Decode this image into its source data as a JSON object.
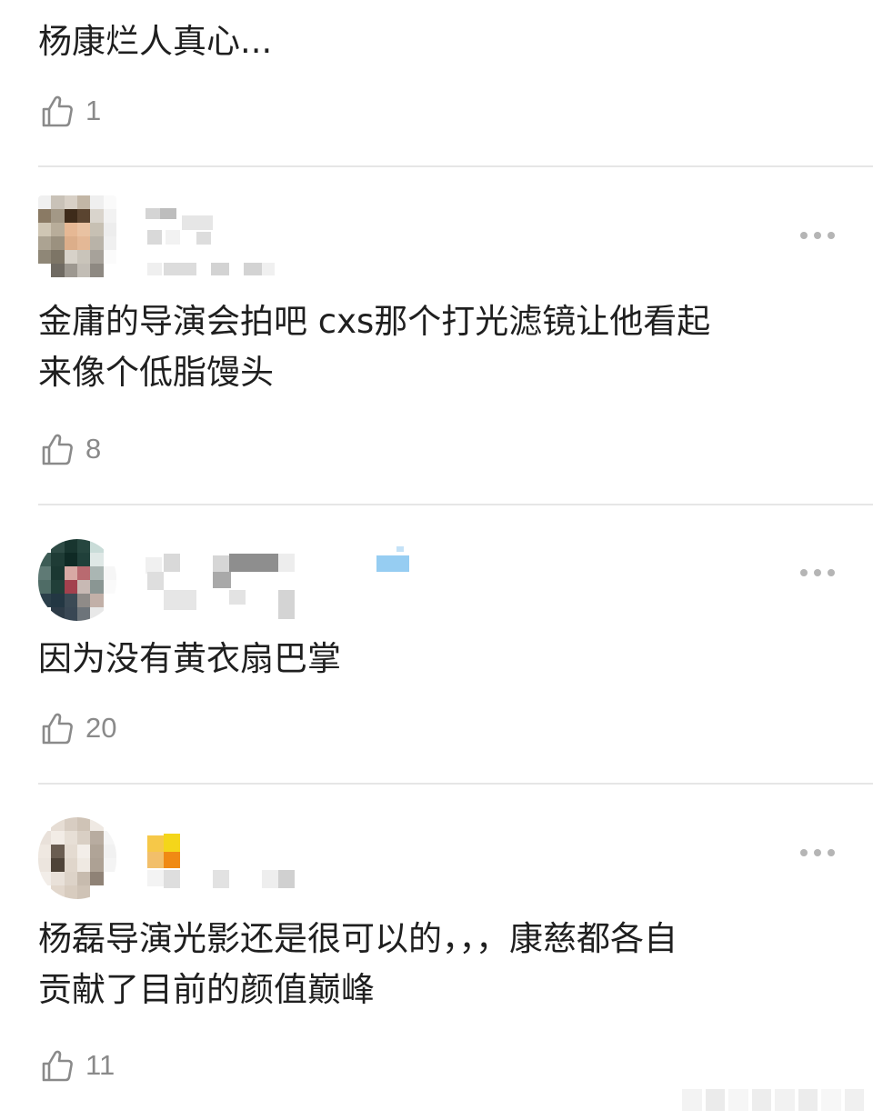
{
  "top_comment": {
    "text": "杨康烂人真心...",
    "likes": "1"
  },
  "comments": [
    {
      "text": "金庸的导演会拍吧 cxs那个打光滤镜让他看起\n来像个低脂馒头",
      "likes": "8"
    },
    {
      "text": "因为没有黄衣扇巴掌",
      "likes": "20"
    },
    {
      "text": "杨磊导演光影还是很可以的，，，康慈都各自\n贡献了目前的颜值巅峰",
      "likes": "11"
    }
  ],
  "icons": {
    "like": "thumbs-up-icon",
    "more": "more-dots-icon"
  },
  "colors": {
    "text": "#1f1f1f",
    "meta": "#8a8a8a",
    "divider": "#e6e6e6"
  }
}
